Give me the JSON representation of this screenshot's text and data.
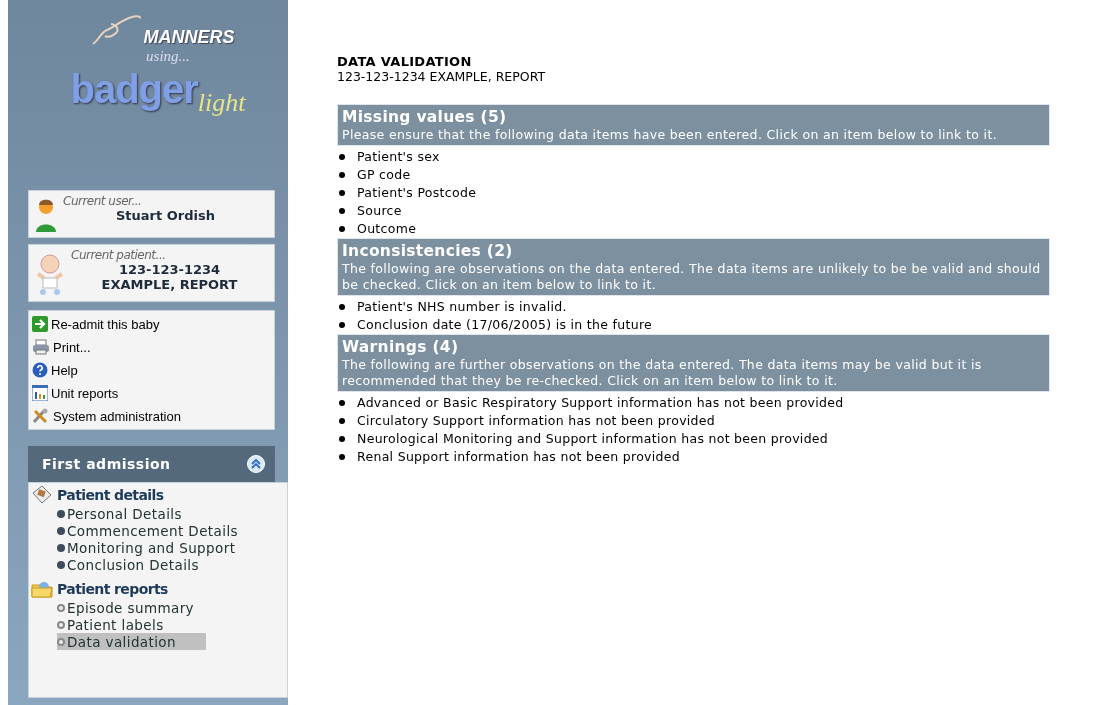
{
  "logo": {
    "brand": "MANNERS",
    "connector": "using...",
    "product": "badger",
    "product_suffix": "light"
  },
  "current_user": {
    "label": "Current user...",
    "name": "Stuart Ordish"
  },
  "current_patient": {
    "label": "Current patient...",
    "id": "123-123-1234",
    "name": "EXAMPLE, REPORT"
  },
  "actions": [
    {
      "label": "Re-admit this baby",
      "kind": "readmit"
    },
    {
      "label": "Print...",
      "kind": "print"
    },
    {
      "label": "Help",
      "kind": "help"
    },
    {
      "label": "Unit reports",
      "kind": "reports"
    },
    {
      "label": "System administration",
      "kind": "admin"
    }
  ],
  "admission": {
    "title": "First admission",
    "expanded": true,
    "groups": [
      {
        "title": "Patient details",
        "kind": "details",
        "items": [
          {
            "label": "Personal Details",
            "selected": false
          },
          {
            "label": "Commencement Details",
            "selected": false
          },
          {
            "label": "Monitoring and Support",
            "selected": false
          },
          {
            "label": "Conclusion Details",
            "selected": false
          }
        ]
      },
      {
        "title": "Patient reports",
        "kind": "reports",
        "items": [
          {
            "label": "Episode summary",
            "selected": false
          },
          {
            "label": "Patient labels",
            "selected": false
          },
          {
            "label": "Data validation",
            "selected": true
          }
        ]
      }
    ]
  },
  "page": {
    "title": "DATA VALIDATION",
    "subtitle": "123-123-1234 EXAMPLE, REPORT",
    "sections": [
      {
        "title": "Missing values (5)",
        "description": "Please ensure that the following data items have been entered. Click on an item below to link to it.",
        "items": [
          "Patient's sex",
          "GP code",
          "Patient's Postcode",
          "Source",
          "Outcome"
        ]
      },
      {
        "title": "Inconsistencies (2)",
        "description": "The following are observations on the data entered. The data items are unlikely to be be valid and should be checked. Click on an item below to link to it.",
        "items": [
          "Patient's NHS number is invalid.",
          "Conclusion date (17/06/2005) is in the future"
        ]
      },
      {
        "title": "Warnings (4)",
        "description": "The following are further observations on the data entered. The data items may be valid but it is recommended that they be re-checked. Click on an item below to link to it.",
        "items": [
          "Advanced or Basic Respiratory Support information has not been provided",
          "Circulatory Support information has not been provided",
          "Neurological Monitoring and Support information has not been provided",
          "Renal Support information has not been provided"
        ]
      }
    ]
  }
}
